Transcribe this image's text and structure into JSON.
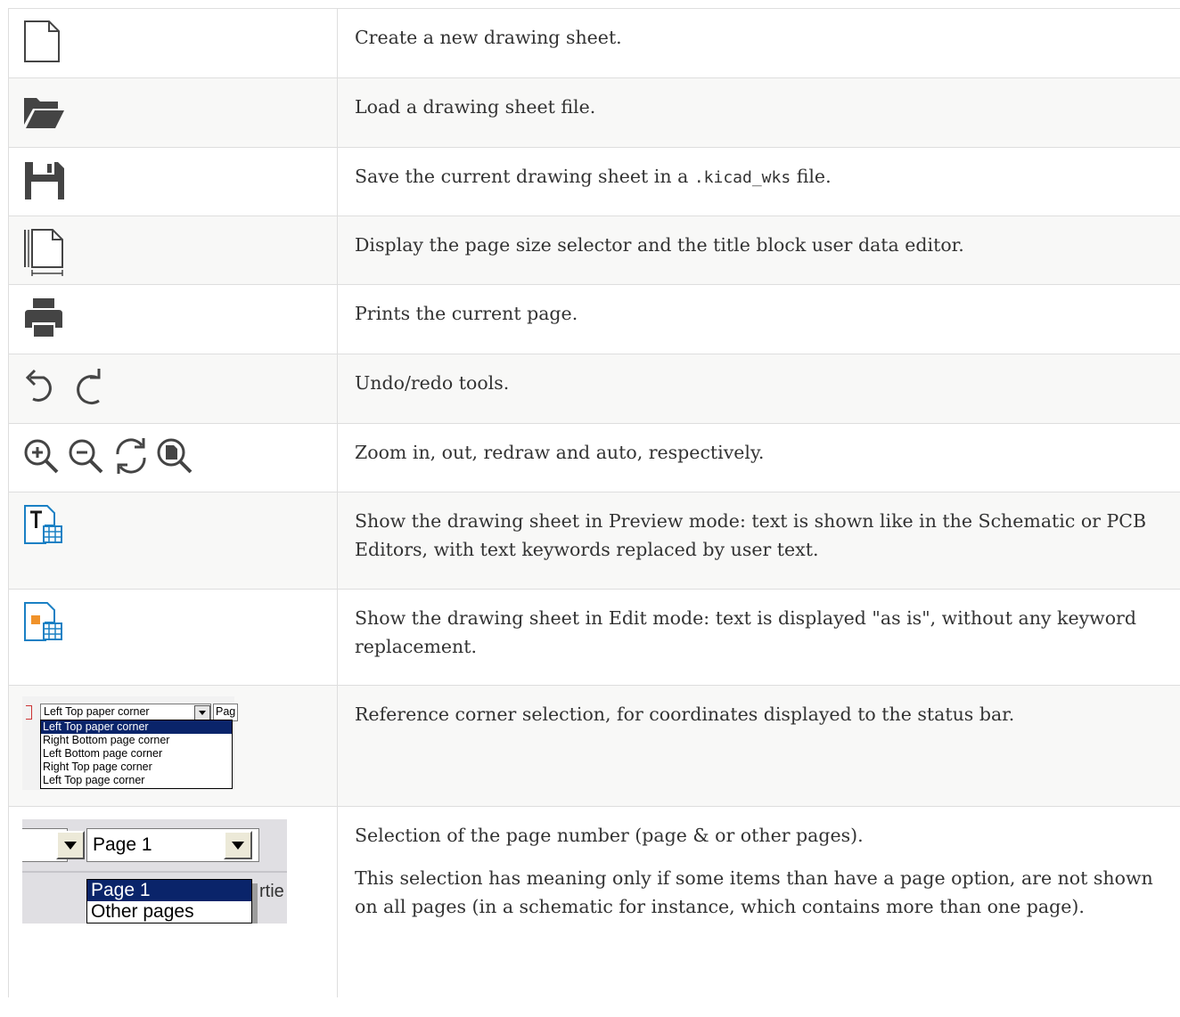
{
  "rows": [
    {
      "icon": "new-document-icon",
      "text": "Create a new drawing sheet."
    },
    {
      "icon": "open-folder-icon",
      "text": "Load a drawing sheet file."
    },
    {
      "icon": "save-floppy-icon",
      "text_before": "Save the current drawing sheet in a ",
      "code": ".kicad_wks",
      "text_after": " file."
    },
    {
      "icon": "page-settings-icon",
      "text": "Display the page size selector and the title block user data editor."
    },
    {
      "icon": "print-icon",
      "text": "Prints the current page."
    },
    {
      "icons": [
        "undo-icon",
        "redo-icon"
      ],
      "text": "Undo/redo tools."
    },
    {
      "icons": [
        "zoom-in-icon",
        "zoom-out-icon",
        "redraw-icon",
        "zoom-auto-icon"
      ],
      "text": "Zoom in, out, redraw and auto, respectively."
    },
    {
      "icon": "preview-mode-icon",
      "text": "Show the drawing sheet in Preview mode: text is shown like in the Schematic or PCB Editors, with text keywords replaced by user text."
    },
    {
      "icon": "edit-mode-icon",
      "text": "Show the drawing sheet in Edit mode: text is displayed \"as is\", without any keyword replacement."
    },
    {
      "text": "Reference corner selection, for coordinates displayed to the status bar."
    },
    {
      "paragraphs": [
        "Selection of the page number (page & or other pages).",
        "This selection has meaning only if some items than have a page option, are not shown on all pages (in a schematic for instance, which contains more than one page)."
      ]
    }
  ],
  "corner_dropdown": {
    "selected": "Left Top paper corner",
    "next_combo_text": "Pag",
    "options": [
      "Left Top paper corner",
      "Right Bottom page corner",
      "Left Bottom page corner",
      "Right Top page corner",
      "Left Top page corner"
    ]
  },
  "page_dropdown": {
    "selected": "Page 1",
    "options": [
      "Page 1",
      "Other pages"
    ],
    "behind_text": "rtie"
  },
  "colors": {
    "border": "#dedede",
    "stripe": "#f8f8f7",
    "text": "#333333",
    "icon_blue": "#1a80c4",
    "icon_orange": "#f0922a",
    "selection": "#0a246a"
  }
}
